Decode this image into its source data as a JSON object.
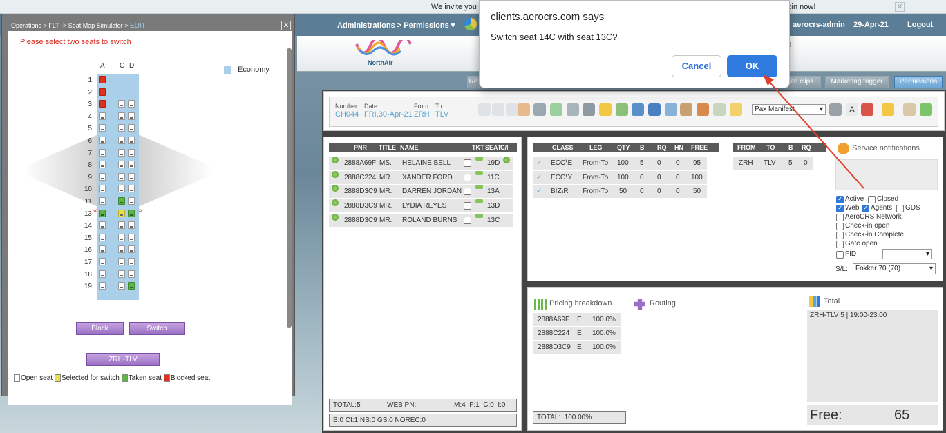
{
  "banner": {
    "text_left": "We invite you t",
    "text_right": "join now!"
  },
  "topbar": {
    "nav": "Administrations > Permissions",
    "user": "aerocrs-admin",
    "date": "29-Apr-21",
    "logout": "Logout"
  },
  "brand": {
    "logo_text": "NorthAir",
    "partial_text": "S!"
  },
  "tabs": [
    "Re",
    "site clips",
    "Marketing trigger",
    "Permissions"
  ],
  "flight": {
    "number_label": "Number:",
    "number": "CH044",
    "date_label": "Date:",
    "date": "FRI,30-Apr-21",
    "from_label": "From:",
    "from": "ZRH",
    "to_label": "To:",
    "to": "TLV",
    "manifest_select": "Pax Manifest"
  },
  "pax": {
    "headers": [
      "PNR",
      "TITLE",
      "NAME",
      "TKT",
      "SEAT",
      "C/I"
    ],
    "rows": [
      {
        "pnr": "2888A69F",
        "title": "MS.",
        "name": "HELAINE BELL",
        "seat": "19D"
      },
      {
        "pnr": "2888C224",
        "title": "MR.",
        "name": "XANDER FORD",
        "seat": "11C"
      },
      {
        "pnr": "2888D3C9",
        "title": "MR.",
        "name": "DARREN JORDAN",
        "seat": "13A"
      },
      {
        "pnr": "2888D3C9",
        "title": "MR.",
        "name": "LYDIA REYES",
        "seat": "13D"
      },
      {
        "pnr": "2888D3C9",
        "title": "MR.",
        "name": "ROLAND BURNS",
        "seat": "13C"
      }
    ],
    "footer1": {
      "total": "TOTAL:5",
      "webpn": "WEB PN:",
      "counts": "M:4  F:1  C:0  I:0"
    },
    "footer2": "B:0 CI:1 NS:0 GS:0 NOREC:0"
  },
  "classes": {
    "headers": [
      "CLASS",
      "LEG",
      "QTY",
      "B",
      "RQ",
      "HN",
      "FREE"
    ],
    "rows": [
      {
        "cls": "ECO\\E",
        "leg": "From-To",
        "qty": "100",
        "b": "5",
        "rq": "0",
        "hn": "0",
        "free": "95"
      },
      {
        "cls": "ECO\\Y",
        "leg": "From-To",
        "qty": "100",
        "b": "0",
        "rq": "0",
        "hn": "0",
        "free": "100"
      },
      {
        "cls": "BIZ\\R",
        "leg": "From-To",
        "qty": "50",
        "b": "0",
        "rq": "0",
        "hn": "0",
        "free": "50"
      }
    ]
  },
  "legs": {
    "headers": [
      "FROM",
      "TO",
      "B",
      "RQ"
    ],
    "row": {
      "from": "ZRH",
      "to": "TLV",
      "b": "5",
      "rq": "0"
    }
  },
  "service": {
    "title": "Service notifications",
    "options": [
      {
        "label": "Active",
        "checked": true
      },
      {
        "label": "Closed",
        "checked": false
      },
      {
        "label": "Web",
        "checked": true
      },
      {
        "label": "Agents",
        "checked": true
      },
      {
        "label": "GDS",
        "checked": false
      },
      {
        "label": "AeroCRS Network",
        "checked": false
      },
      {
        "label": "Check-in open",
        "checked": false
      },
      {
        "label": "Check-in Complete",
        "checked": false
      },
      {
        "label": "Gate open",
        "checked": false
      },
      {
        "label": "FID",
        "checked": false
      }
    ],
    "sl_label": "S/L:",
    "sl_value": "Fokker 70 (70)"
  },
  "pricing": {
    "title": "Pricing breakdown",
    "rows": [
      {
        "pnr": "2888A69F",
        "cls": "E",
        "pct": "100.0%"
      },
      {
        "pnr": "2888C224",
        "cls": "E",
        "pct": "100.0%"
      },
      {
        "pnr": "2888D3C9",
        "cls": "E",
        "pct": "100.0%"
      }
    ],
    "total": "TOTAL:  100.00%"
  },
  "routing": {
    "title": "Routing"
  },
  "total_panel": {
    "title": "Total",
    "line": "ZRH-TLV 5 | 19:00-23:00",
    "free_label": "Free:",
    "free_value": "65"
  },
  "seatmap": {
    "breadcrumb": "Operations > FLT -> Seat Map Simulator > ",
    "edit": "EDIT",
    "message": "Please select two seats to switch",
    "columns": [
      "A",
      "C",
      "D"
    ],
    "economy_label": "Economy",
    "rows": [
      {
        "n": "1",
        "a": "b",
        "c": "",
        "d": ""
      },
      {
        "n": "2",
        "a": "b",
        "c": "",
        "d": ""
      },
      {
        "n": "3",
        "a": "b",
        "c": "o",
        "d": "o"
      },
      {
        "n": "4",
        "a": "o",
        "c": "o",
        "d": "o"
      },
      {
        "n": "5",
        "a": "o",
        "c": "o",
        "d": "o"
      },
      {
        "n": "6",
        "a": "o",
        "c": "o",
        "d": "o"
      },
      {
        "n": "7",
        "a": "o",
        "c": "o",
        "d": "o"
      },
      {
        "n": "8",
        "a": "o",
        "c": "o",
        "d": "o"
      },
      {
        "n": "9",
        "a": "o",
        "c": "o",
        "d": "o"
      },
      {
        "n": "10",
        "a": "o",
        "c": "o",
        "d": "o"
      },
      {
        "n": "11",
        "a": "o",
        "c": "t",
        "d": "o"
      },
      {
        "n": "13",
        "a": "t",
        "c": "s",
        "d": "t"
      },
      {
        "n": "14",
        "a": "o",
        "c": "o",
        "d": "o"
      },
      {
        "n": "15",
        "a": "o",
        "c": "o",
        "d": "o"
      },
      {
        "n": "16",
        "a": "o",
        "c": "o",
        "d": "o"
      },
      {
        "n": "17",
        "a": "o",
        "c": "o",
        "d": "o"
      },
      {
        "n": "18",
        "a": "o",
        "c": "o",
        "d": "o"
      },
      {
        "n": "19",
        "a": "o",
        "c": "o",
        "d": "t"
      }
    ],
    "block_button": "Block",
    "switch_button": "Switch",
    "route_button": "ZRH-TLV",
    "legend": [
      "Open seat",
      "Selected for switch",
      "Taken seat",
      "Blocked seat"
    ]
  },
  "dialog": {
    "origin": "clients.aerocrs.com says",
    "message": "Switch seat 14C with seat 13C?",
    "cancel": "Cancel",
    "ok": "OK"
  },
  "colors": {
    "accent": "#2f7be0",
    "alert_text": "#d62d20",
    "seat_blocked": "#e03020",
    "seat_taken": "#5fb34a",
    "seat_selected": "#e8e04a",
    "economy": "#aacfe8"
  }
}
